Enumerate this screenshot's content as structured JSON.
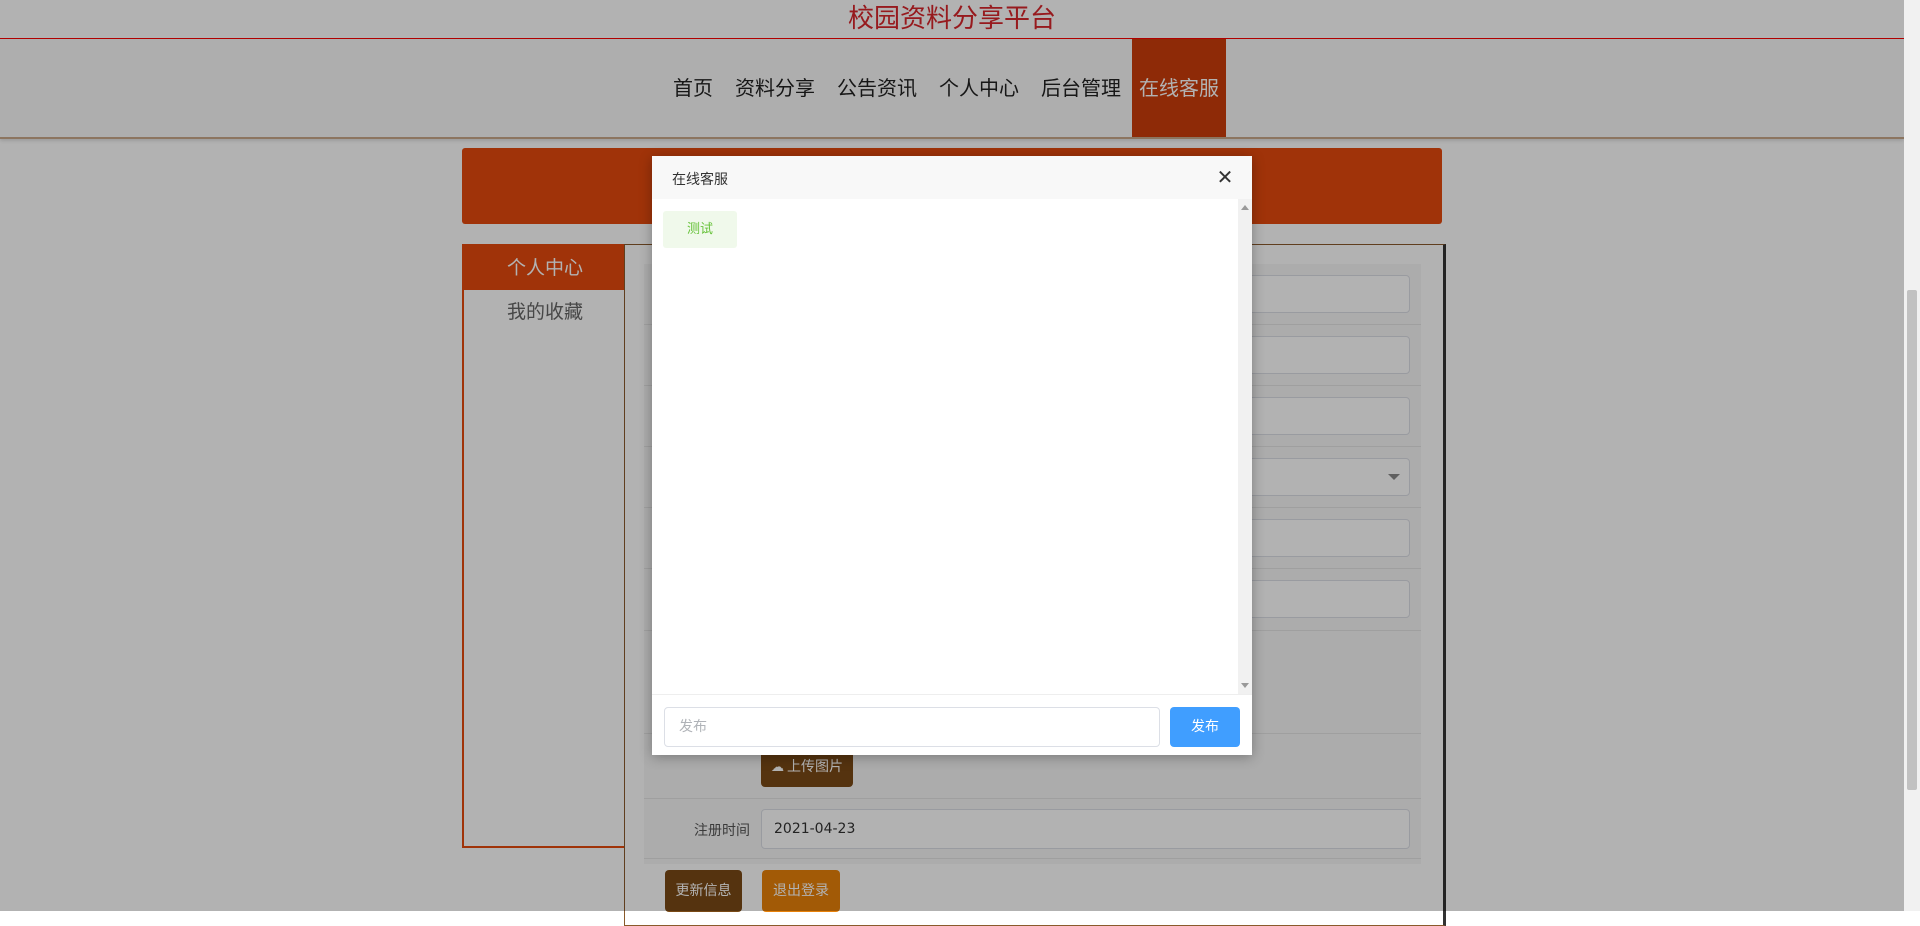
{
  "header": {
    "site_title": "校园资料分享平台"
  },
  "nav": {
    "items": [
      {
        "label": "首页"
      },
      {
        "label": "资料分享"
      },
      {
        "label": "公告资讯"
      },
      {
        "label": "个人中心"
      },
      {
        "label": "后台管理"
      },
      {
        "label": "在线客服",
        "active": true
      }
    ]
  },
  "sidebar": {
    "items": [
      {
        "label": "个人中心",
        "active": true
      },
      {
        "label": "我的收藏"
      }
    ]
  },
  "form": {
    "upload_label": "上传图片",
    "reg_time_label": "注册时间",
    "reg_time_value": "2021-04-23",
    "update_label": "更新信息",
    "logout_label": "退出登录"
  },
  "dialog": {
    "title": "在线客服",
    "messages": [
      {
        "text": "测试"
      }
    ],
    "input_placeholder": "发布",
    "send_label": "发布"
  },
  "colors": {
    "brand_orange": "#e64a0e",
    "title_red": "#d8262c",
    "primary_blue": "#409eff",
    "brown": "#7a4a16"
  }
}
